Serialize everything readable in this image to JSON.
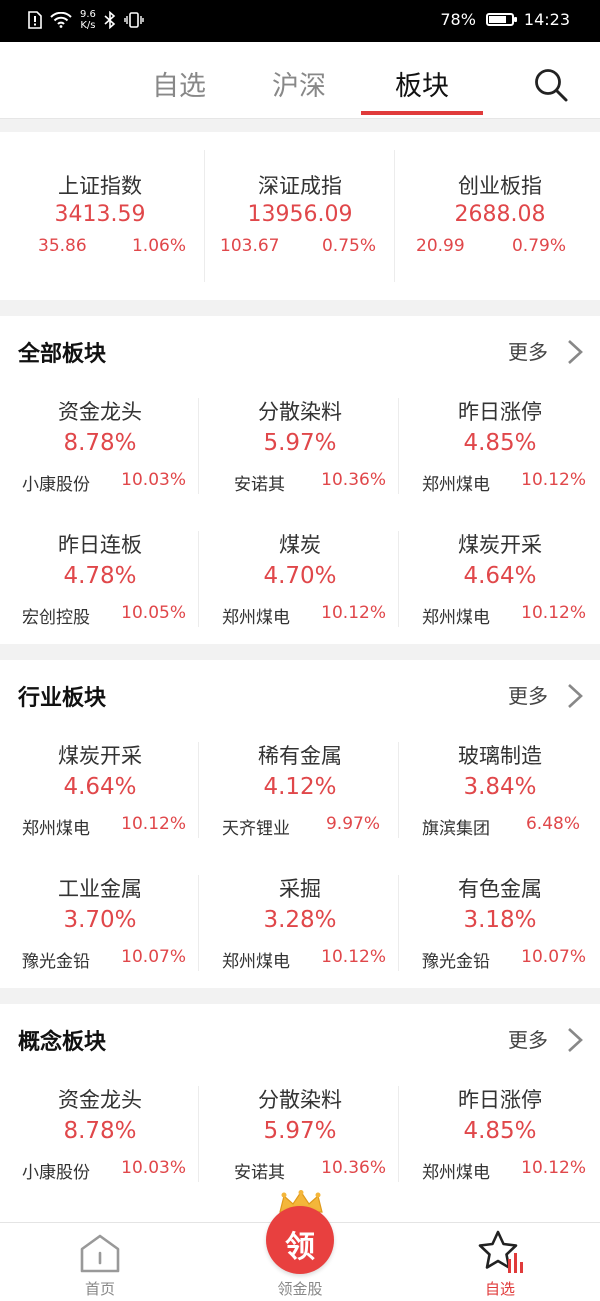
{
  "status_bar": {
    "speed_value": "9.6",
    "speed_unit": "K/s",
    "battery": "78%",
    "battery_level": 0.78,
    "time": "14:23"
  },
  "tabs": [
    {
      "label": "自选",
      "active": false
    },
    {
      "label": "沪深",
      "active": false
    },
    {
      "label": "板块",
      "active": true
    }
  ],
  "indices": [
    {
      "name": "上证指数",
      "value": "3413.59",
      "change": "35.86",
      "pct": "1.06%"
    },
    {
      "name": "深证成指",
      "value": "13956.09",
      "change": "103.67",
      "pct": "0.75%"
    },
    {
      "name": "创业板指",
      "value": "2688.08",
      "change": "20.99",
      "pct": "0.79%"
    }
  ],
  "sections": [
    {
      "title": "全部板块",
      "more": "更多",
      "items": [
        {
          "name": "资金龙头",
          "pct": "8.78%",
          "stock": "小康股份",
          "stock_pct": "10.03%"
        },
        {
          "name": "分散染料",
          "pct": "5.97%",
          "stock": "安诺其",
          "stock_pct": "10.36%"
        },
        {
          "name": "昨日涨停",
          "pct": "4.85%",
          "stock": "郑州煤电",
          "stock_pct": "10.12%"
        },
        {
          "name": "昨日连板",
          "pct": "4.78%",
          "stock": "宏创控股",
          "stock_pct": "10.05%"
        },
        {
          "name": "煤炭",
          "pct": "4.70%",
          "stock": "郑州煤电",
          "stock_pct": "10.12%"
        },
        {
          "name": "煤炭开采",
          "pct": "4.64%",
          "stock": "郑州煤电",
          "stock_pct": "10.12%"
        }
      ]
    },
    {
      "title": "行业板块",
      "more": "更多",
      "items": [
        {
          "name": "煤炭开采",
          "pct": "4.64%",
          "stock": "郑州煤电",
          "stock_pct": "10.12%"
        },
        {
          "name": "稀有金属",
          "pct": "4.12%",
          "stock": "天齐锂业",
          "stock_pct": "9.97%"
        },
        {
          "name": "玻璃制造",
          "pct": "3.84%",
          "stock": "旗滨集团",
          "stock_pct": "6.48%"
        },
        {
          "name": "工业金属",
          "pct": "3.70%",
          "stock": "豫光金铅",
          "stock_pct": "10.07%"
        },
        {
          "name": "采掘",
          "pct": "3.28%",
          "stock": "郑州煤电",
          "stock_pct": "10.12%"
        },
        {
          "name": "有色金属",
          "pct": "3.18%",
          "stock": "豫光金铅",
          "stock_pct": "10.07%"
        }
      ]
    },
    {
      "title": "概念板块",
      "more": "更多",
      "items": [
        {
          "name": "资金龙头",
          "pct": "8.78%",
          "stock": "小康股份",
          "stock_pct": "10.03%"
        },
        {
          "name": "分散染料",
          "pct": "5.97%",
          "stock": "安诺其",
          "stock_pct": "10.36%"
        },
        {
          "name": "昨日涨停",
          "pct": "4.85%",
          "stock": "郑州煤电",
          "stock_pct": "10.12%"
        }
      ]
    }
  ],
  "bottom_nav": {
    "home": "首页",
    "gold": "领金股",
    "gold_badge": "领",
    "favorites": "自选"
  },
  "colors": {
    "up_red": "#e0474a",
    "accent": "#e03b3b"
  },
  "icons": [
    "sim-alert-icon",
    "wifi-icon",
    "bluetooth-icon",
    "vibrate-icon",
    "battery-icon",
    "search-icon",
    "chevron-right-icon",
    "home-icon",
    "crown-icon",
    "star-chart-icon"
  ]
}
